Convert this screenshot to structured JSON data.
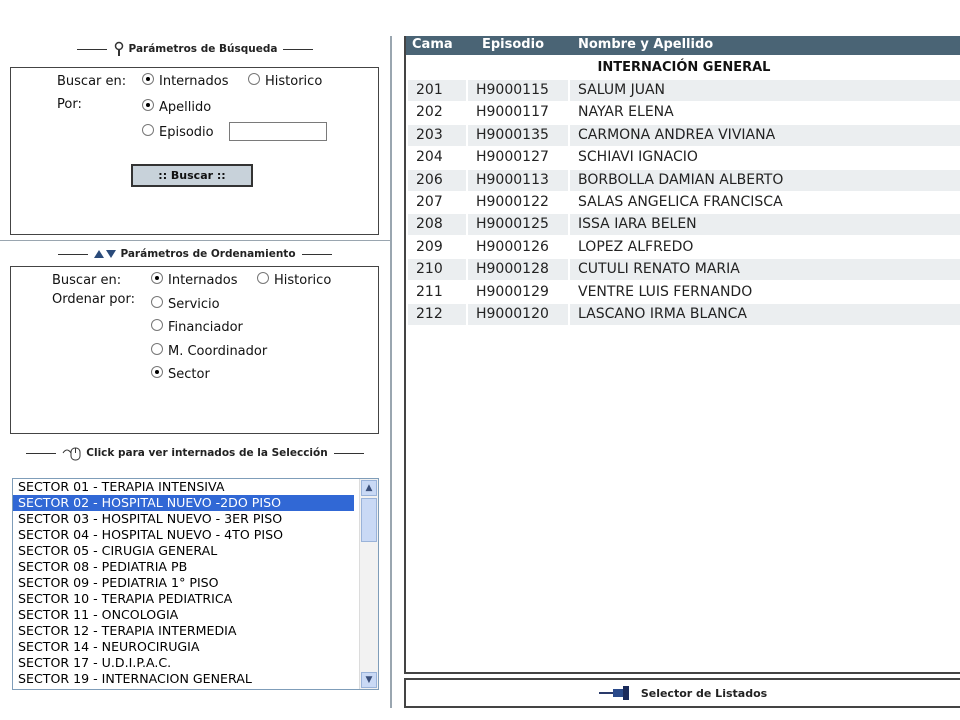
{
  "search_section": {
    "title": "Parámetros de Búsqueda",
    "buscar_label": "Buscar en:",
    "por_label": "Por:",
    "opt_internados": "Internados",
    "opt_historico": "Historico",
    "opt_apellido": "Apellido",
    "opt_episodio": "Episodio",
    "episodio_value": "",
    "button": ":: Buscar ::"
  },
  "order_section": {
    "title": "Parámetros de Ordenamiento",
    "buscar_label": "Buscar en:",
    "ordenar_label": "Ordenar por:",
    "opt_internados": "Internados",
    "opt_historico": "Historico",
    "opt_servicio": "Servicio",
    "opt_financiador": "Financiador",
    "opt_coordinador": "M. Coordinador",
    "opt_sector": "Sector"
  },
  "selection_section": {
    "title": "Click para ver internados de la Selección",
    "sectors": [
      "SECTOR 01 - TERAPIA INTENSIVA",
      "SECTOR 02 - HOSPITAL NUEVO -2DO PISO",
      "SECTOR 03 - HOSPITAL NUEVO - 3ER PISO",
      "SECTOR 04 - HOSPITAL NUEVO - 4TO PISO",
      "SECTOR 05 - CIRUGIA GENERAL",
      "SECTOR 08 - PEDIATRIA PB",
      "SECTOR 09 - PEDIATRIA 1° PISO",
      "SECTOR 10 - TERAPIA PEDIATRICA",
      "SECTOR 11 - ONCOLOGIA",
      "SECTOR 12 - TERAPIA INTERMEDIA",
      "SECTOR 14 - NEUROCIRUGIA",
      "SECTOR 17 - U.D.I.P.A.C.",
      "SECTOR 19 - INTERNACION GENERAL"
    ],
    "selected": "SECTOR 02 - HOSPITAL NUEVO -2DO PISO"
  },
  "table": {
    "headers": {
      "cama": "Cama",
      "episodio": "Episodio",
      "nombre": "Nombre y Apellido"
    },
    "group": "INTERNACIÓN GENERAL",
    "rows": [
      {
        "cama": "201",
        "episodio": "H9000115",
        "nombre": "SALUM JUAN"
      },
      {
        "cama": "202",
        "episodio": "H9000117",
        "nombre": "NAYAR ELENA"
      },
      {
        "cama": "203",
        "episodio": "H9000135",
        "nombre": "CARMONA ANDREA VIVIANA"
      },
      {
        "cama": "204",
        "episodio": "H9000127",
        "nombre": "SCHIAVI IGNACIO"
      },
      {
        "cama": "206",
        "episodio": "H9000113",
        "nombre": "BORBOLLA DAMIAN ALBERTO"
      },
      {
        "cama": "207",
        "episodio": "H9000122",
        "nombre": "SALAS ANGELICA FRANCISCA"
      },
      {
        "cama": "208",
        "episodio": "H9000125",
        "nombre": "ISSA IARA BELEN"
      },
      {
        "cama": "209",
        "episodio": "H9000126",
        "nombre": "LOPEZ ALFREDO"
      },
      {
        "cama": "210",
        "episodio": "H9000128",
        "nombre": "CUTULI RENATO MARIA"
      },
      {
        "cama": "211",
        "episodio": "H9000129",
        "nombre": "VENTRE LUIS FERNANDO"
      },
      {
        "cama": "212",
        "episodio": "H9000120",
        "nombre": "LASCANO IRMA BLANCA"
      }
    ]
  },
  "footer": {
    "label": "Selector de Listados"
  },
  "icons": {
    "search_header": "magnifier-icon",
    "order_header": "sort-arrows-icon",
    "selection_header": "mouse-click-icon",
    "footer": "pushpin-icon"
  },
  "colors": {
    "table_header_bg": "#4a6475",
    "alt_row_bg": "#ebeef0",
    "selected_item_bg": "#3168d5",
    "button_bg": "#c8d2da"
  }
}
